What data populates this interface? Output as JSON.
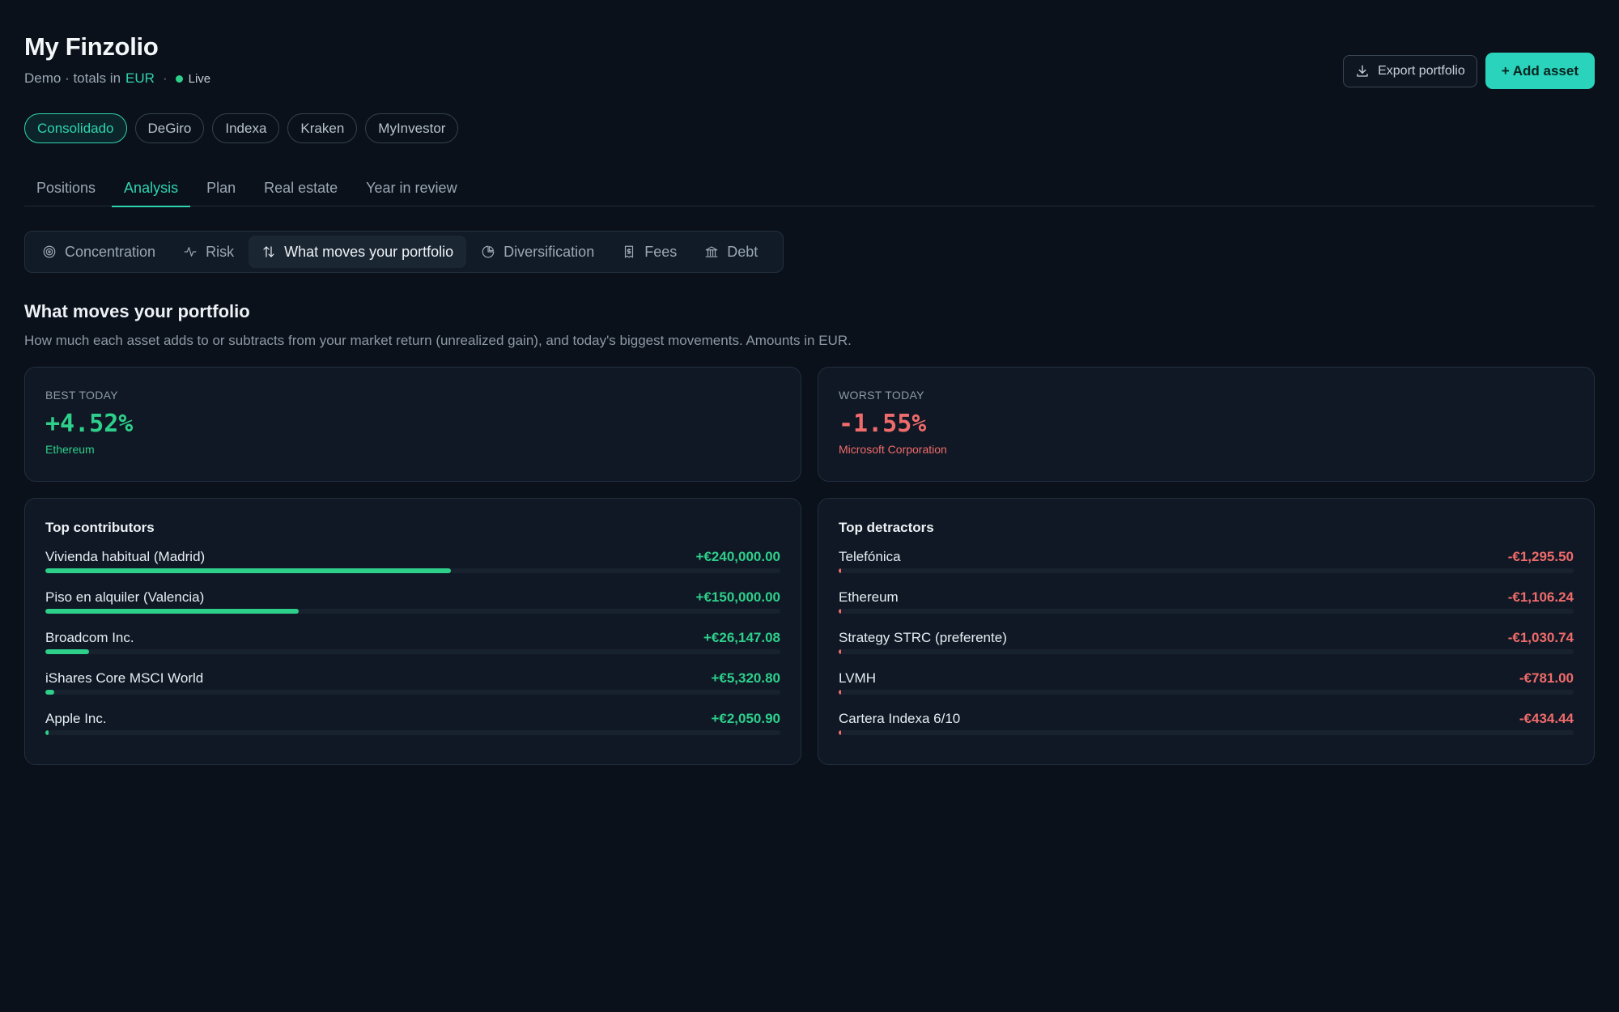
{
  "header": {
    "title": "My Finzolio",
    "subtitle_prefix": "Demo · totals in",
    "currency": "EUR",
    "separator": "·",
    "status": "Live",
    "export_label": "Export portfolio",
    "add_label": "+ Add asset"
  },
  "accounts": [
    {
      "label": "Consolidado",
      "active": true
    },
    {
      "label": "DeGiro",
      "active": false
    },
    {
      "label": "Indexa",
      "active": false
    },
    {
      "label": "Kraken",
      "active": false
    },
    {
      "label": "MyInvestor",
      "active": false
    }
  ],
  "tabs": [
    {
      "label": "Positions",
      "active": false
    },
    {
      "label": "Analysis",
      "active": true
    },
    {
      "label": "Plan",
      "active": false
    },
    {
      "label": "Real estate",
      "active": false
    },
    {
      "label": "Year in review",
      "active": false
    }
  ],
  "analysis_tabs": [
    {
      "label": "Concentration",
      "icon": "target-icon",
      "active": false
    },
    {
      "label": "Risk",
      "icon": "activity-icon",
      "active": false
    },
    {
      "label": "What moves your portfolio",
      "icon": "arrows-up-down-icon",
      "active": true
    },
    {
      "label": "Diversification",
      "icon": "pie-chart-icon",
      "active": false
    },
    {
      "label": "Fees",
      "icon": "receipt-icon",
      "active": false
    },
    {
      "label": "Debt",
      "icon": "bank-icon",
      "active": false
    }
  ],
  "section": {
    "title": "What moves your portfolio",
    "description": "How much each asset adds to or subtracts from your market return (unrealized gain), and today's biggest movements. Amounts in EUR."
  },
  "best_today": {
    "label": "BEST TODAY",
    "value": "+4.52%",
    "asset": "Ethereum"
  },
  "worst_today": {
    "label": "WORST TODAY",
    "value": "-1.55%",
    "asset": "Microsoft Corporation"
  },
  "contributors": {
    "title": "Top contributors",
    "items": [
      {
        "name": "Vivienda habitual (Madrid)",
        "value": "+€240,000.00",
        "share": 0.552
      },
      {
        "name": "Piso en alquiler (Valencia)",
        "value": "+€150,000.00",
        "share": 0.345
      },
      {
        "name": "Broadcom Inc.",
        "value": "+€26,147.08",
        "share": 0.06
      },
      {
        "name": "iShares Core MSCI World",
        "value": "+€5,320.80",
        "share": 0.012
      },
      {
        "name": "Apple Inc.",
        "value": "+€2,050.90",
        "share": 0.004
      }
    ]
  },
  "detractors": {
    "title": "Top detractors",
    "items": [
      {
        "name": "Telefónica",
        "value": "-€1,295.50",
        "share": 0.003
      },
      {
        "name": "Ethereum",
        "value": "-€1,106.24",
        "share": 0.003
      },
      {
        "name": "Strategy STRC (preferente)",
        "value": "-€1,030.74",
        "share": 0.0025
      },
      {
        "name": "LVMH",
        "value": "-€781.00",
        "share": 0.002
      },
      {
        "name": "Cartera Indexa 6/10",
        "value": "-€434.44",
        "share": 0.001
      }
    ]
  },
  "colors": {
    "accent": "#2ad3bb",
    "positive": "#2ecf8b",
    "negative": "#f06b6b",
    "background": "#0a111a"
  }
}
